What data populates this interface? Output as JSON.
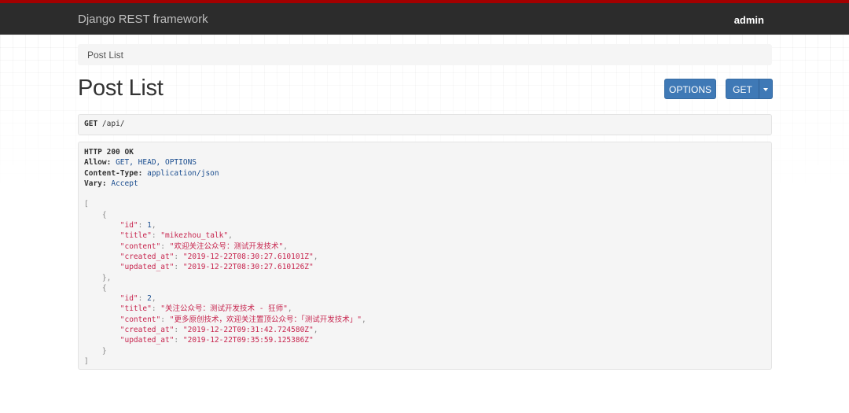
{
  "navbar": {
    "brand": "Django REST framework",
    "user": "admin"
  },
  "breadcrumb": {
    "label": "Post List"
  },
  "page": {
    "title": "Post List"
  },
  "buttons": {
    "options": "OPTIONS",
    "get": "GET",
    "caret_icon": "caret-down-icon"
  },
  "request": {
    "method": "GET",
    "path": "/api/"
  },
  "response": {
    "status_line": "HTTP 200 OK",
    "headers": [
      {
        "name": "Allow:",
        "value": "GET, HEAD, OPTIONS"
      },
      {
        "name": "Content-Type:",
        "value": "application/json"
      },
      {
        "name": "Vary:",
        "value": "Accept"
      }
    ],
    "items": [
      {
        "id": "1",
        "title": "mikezhou_talk",
        "content": "欢迎关注公众号：测试开发技术",
        "created_at": "2019-12-22T08:30:27.610101Z",
        "updated_at": "2019-12-22T08:30:27.610126Z"
      },
      {
        "id": "2",
        "title": "关注公众号：测试开发技术 - 狂师",
        "content": "更多原创技术，欢迎关注置顶公众号：「测试开发技术」",
        "created_at": "2019-12-22T09:31:42.724580Z",
        "updated_at": "2019-12-22T09:35:59.125386Z"
      }
    ]
  },
  "colors": {
    "navbar_bg": "#2c2c2c",
    "navbar_accent": "#a30000",
    "button_bg": "#3f79b6"
  }
}
